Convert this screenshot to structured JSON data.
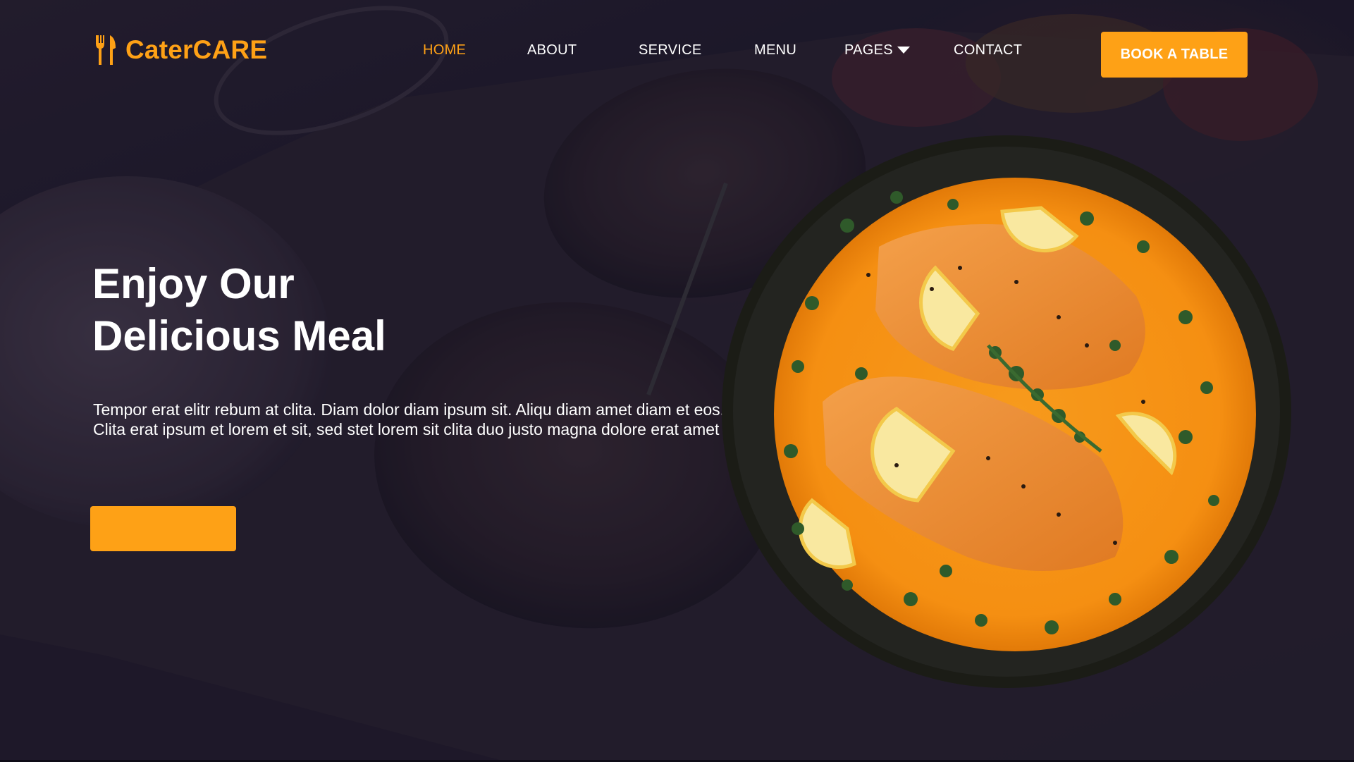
{
  "brand": {
    "name": "CaterCARE",
    "icon": "utensils-icon",
    "color": "#fea116"
  },
  "nav": {
    "items": [
      {
        "label": "HOME",
        "active": true
      },
      {
        "label": "ABOUT",
        "active": false
      },
      {
        "label": "SERVICE",
        "active": false
      },
      {
        "label": "MENU",
        "active": false
      },
      {
        "label": "PAGES",
        "active": false,
        "dropdown": true
      },
      {
        "label": "CONTACT",
        "active": false
      }
    ],
    "cta_label": "BOOK A TABLE"
  },
  "hero": {
    "title_line1": "Enjoy Our",
    "title_line2": "Delicious Meal",
    "description": "Tempor erat elitr rebum at clita. Diam dolor diam ipsum sit. Aliqu diam amet diam et eos. Clita erat ipsum et lorem et sit, sed stet lorem sit clita duo justo magna dolore erat amet",
    "button_label": "",
    "image": "salmon-curry-dish-image"
  },
  "colors": {
    "accent": "#fea116",
    "text": "#ffffff",
    "background": "#1e1a2a"
  }
}
